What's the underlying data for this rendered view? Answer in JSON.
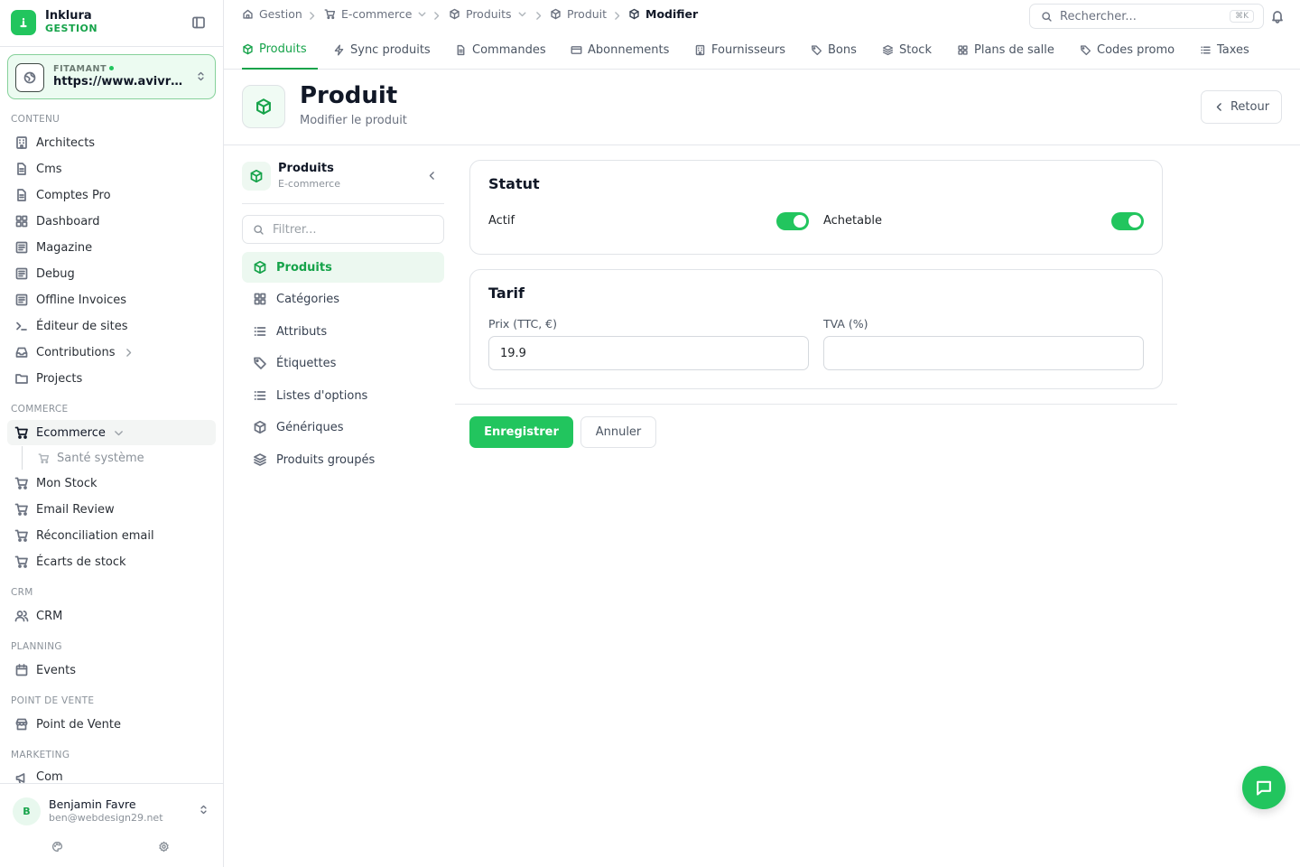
{
  "brand": {
    "name": "Inklura",
    "subtitle": "GESTION"
  },
  "site": {
    "label": "FITAMANT",
    "url": "https://www.avivre-chaussures.fr"
  },
  "sidebar": {
    "sections": [
      {
        "label": "CONTENU"
      },
      {
        "label": "COMMERCE"
      },
      {
        "label": "CRM"
      },
      {
        "label": "PLANNING"
      },
      {
        "label": "POINT DE VENTE"
      },
      {
        "label": "MARKETING"
      }
    ],
    "items": [
      {
        "label": "Architects",
        "icon": "building-icon"
      },
      {
        "label": "Cms",
        "icon": "file-icon"
      },
      {
        "label": "Comptes Pro",
        "icon": "file-icon"
      },
      {
        "label": "Dashboard",
        "icon": "grid-icon"
      },
      {
        "label": "Magazine",
        "icon": "newspaper-icon"
      },
      {
        "label": "Debug",
        "icon": "newspaper-icon"
      },
      {
        "label": "Offline Invoices",
        "icon": "newspaper-icon"
      },
      {
        "label": "Éditeur de sites",
        "icon": "terminal-icon"
      },
      {
        "label": "Contributions",
        "icon": "inbox-icon"
      },
      {
        "label": "Projects",
        "icon": "folder-icon"
      },
      {
        "label": "Ecommerce",
        "icon": "cart-icon"
      },
      {
        "label": "Santé système",
        "icon": "cart-icon"
      },
      {
        "label": "Mon Stock",
        "icon": "cart-icon"
      },
      {
        "label": "Email Review",
        "icon": "cart-icon"
      },
      {
        "label": "Réconciliation email",
        "icon": "cart-icon"
      },
      {
        "label": "Écarts de stock",
        "icon": "cart-icon"
      },
      {
        "label": "CRM",
        "icon": "users-icon"
      },
      {
        "label": "Events",
        "icon": "calendar-icon"
      },
      {
        "label": "Point de Vente",
        "icon": "store-icon"
      },
      {
        "label": "Com",
        "icon": "megaphone-icon"
      }
    ]
  },
  "user": {
    "initial": "B",
    "name": "Benjamin Favre",
    "email": "ben@webdesign29.net"
  },
  "breadcrumb": [
    "Gestion",
    "E-commerce",
    "Produits",
    "Produit",
    "Modifier"
  ],
  "search": {
    "placeholder": "Rechercher...",
    "shortcut": "⌘K"
  },
  "tabs": [
    "Produits",
    "Sync produits",
    "Commandes",
    "Abonnements",
    "Fournisseurs",
    "Bons",
    "Stock",
    "Plans de salle",
    "Codes promo",
    "Taxes"
  ],
  "header": {
    "title": "Produit",
    "subtitle": "Modifier le produit",
    "back_label": "Retour"
  },
  "subnav": {
    "title": "Produits",
    "subtitle": "E-commerce",
    "filter_placeholder": "Filtrer...",
    "items": [
      "Produits",
      "Catégories",
      "Attributs",
      "Étiquettes",
      "Listes d'options",
      "Génériques",
      "Produits groupés"
    ]
  },
  "form": {
    "statut": {
      "title": "Statut",
      "actif_label": "Actif",
      "actif_on": true,
      "achetable_label": "Achetable",
      "achetable_on": true
    },
    "tarif": {
      "title": "Tarif",
      "price_label": "Prix (TTC, €)",
      "price_value": "19.9",
      "tva_label": "TVA (%)",
      "tva_value": ""
    },
    "save_label": "Enregistrer",
    "cancel_label": "Annuler"
  },
  "colors": {
    "accent": "#22c55e",
    "accent_dark": "#16a34a"
  }
}
